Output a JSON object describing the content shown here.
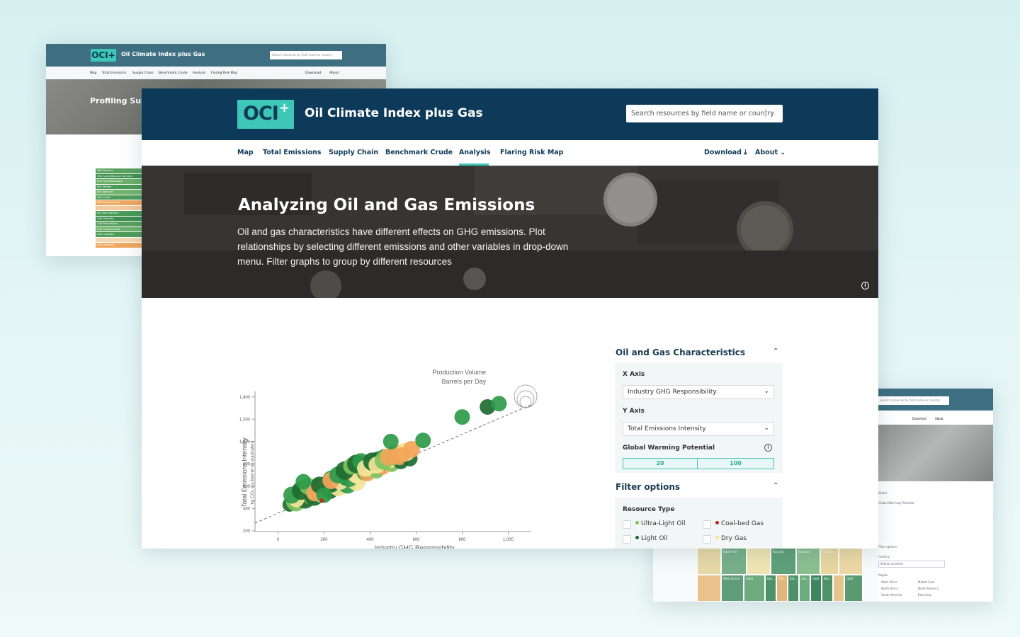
{
  "back_left": {
    "logo_text": "OCI+",
    "title": "Oil Climate Index plus Gas",
    "search_placeholder": "Search resources by field name or country",
    "nav": [
      "Map",
      "Total Emissions",
      "Supply Chain",
      "Benchmark Crude",
      "Analysis",
      "Flaring Risk Map"
    ],
    "download": "Download",
    "about": "About",
    "hero_title": "Profiling Sup",
    "bars": [
      "MEX Tecilisco",
      "VEN Santa Barbara Complex",
      "RUS Kuyumbinskoye",
      "IRN Salman",
      "IRN Agha Jari",
      "SAU Kruda",
      "NYR Wholy Cojang",
      "",
      "IRN Bibi Hakimeh",
      "USA Placerita",
      "CAN Peace River",
      "RUS Surakhanneft",
      "USA Coalinga",
      "",
      "SAU Trebeane"
    ]
  },
  "back_right": {
    "search_placeholder": "Search resources by field name or country",
    "download": "Download",
    "about": "About",
    "model_label": "Model",
    "gwp_label": "Global Warming Potential",
    "filter_label": "Filter options",
    "country_label": "Country",
    "country_placeholder": "Select countries",
    "region_label": "Region",
    "regions": [
      "West Africa",
      "Middle East",
      "North Africa",
      "North America",
      "South America",
      "East Asia"
    ],
    "tree_cells": [
      "Balder UK",
      "Kuruala",
      "Sulaiyah",
      "Ghitsha",
      "West Qurna",
      "Zakit",
      "Bak...",
      "Oth...",
      "Kat...",
      "Zuk...",
      "Gaid",
      "Bani",
      "Qatif"
    ]
  },
  "header": {
    "logo_text": "OCI",
    "logo_plus": "+",
    "title": "Oil Climate Index plus Gas",
    "search_placeholder": "Search resources by field name or country",
    "search_chevron": "⌄"
  },
  "nav": {
    "items": [
      "Map",
      "Total Emissions",
      "Supply Chain",
      "Benchmark Crude",
      "Analysis",
      "Flaring Risk Map"
    ],
    "active": "Analysis",
    "download": "Download ⤓",
    "about": "About ⌄"
  },
  "hero": {
    "title": "Analyzing Oil and Gas Emissions",
    "description": "Oil and gas characteristics have different effects on GHG emissions. Plot relationships by selecting different emissions and other variables in drop-down menu. Filter graphs to group by different resources",
    "info": "i"
  },
  "chart_data": {
    "type": "scatter",
    "xlabel": "Industry GHG Responsibility",
    "ylabel": "Total Emissions Intensity",
    "ylabel_sub": "kg CO₂ eq./barrel oil equivalent",
    "size_legend": [
      "Production Volume",
      "Barrels per Day"
    ],
    "xlim": [
      -100,
      1100
    ],
    "ylim": [
      200,
      1500
    ],
    "x_ticks": [
      0,
      200,
      400,
      600,
      800,
      "1,000"
    ],
    "y_ticks": [
      200,
      400,
      600,
      800,
      "1,000",
      "1,200",
      "1,400"
    ],
    "trend": {
      "x0": -100,
      "y0": 270,
      "x1": 1100,
      "y1": 1330
    },
    "colors": {
      "dark_green": "#1e6b32",
      "green": "#2e9a4a",
      "light_green": "#7ec25e",
      "yellow": "#f3e59a",
      "orange": "#f3a55a",
      "red": "#b8241c"
    },
    "points": [
      {
        "x": 80,
        "y": 480,
        "r": 11,
        "c": "#f3e59a"
      },
      {
        "x": 60,
        "y": 520,
        "r": 12,
        "c": "#2e9a4a"
      },
      {
        "x": 100,
        "y": 560,
        "r": 13,
        "c": "#1e6b32"
      },
      {
        "x": 130,
        "y": 600,
        "r": 12,
        "c": "#7ec25e"
      },
      {
        "x": 110,
        "y": 640,
        "r": 11,
        "c": "#2e9a4a"
      },
      {
        "x": 160,
        "y": 540,
        "r": 12,
        "c": "#f3a55a"
      },
      {
        "x": 180,
        "y": 610,
        "r": 12,
        "c": "#1e6b32"
      },
      {
        "x": 200,
        "y": 520,
        "r": 11,
        "c": "#2e9a4a"
      },
      {
        "x": 190,
        "y": 470,
        "r": 3,
        "c": "#b8241c"
      },
      {
        "x": 230,
        "y": 650,
        "r": 12,
        "c": "#f3a55a"
      },
      {
        "x": 260,
        "y": 700,
        "r": 12,
        "c": "#2e9a4a"
      },
      {
        "x": 290,
        "y": 740,
        "r": 13,
        "c": "#1e6b32"
      },
      {
        "x": 320,
        "y": 780,
        "r": 12,
        "c": "#7ec25e"
      },
      {
        "x": 340,
        "y": 800,
        "r": 13,
        "c": "#1e6b32"
      },
      {
        "x": 360,
        "y": 820,
        "r": 12,
        "c": "#2e9a4a"
      },
      {
        "x": 380,
        "y": 760,
        "r": 12,
        "c": "#f3e59a"
      },
      {
        "x": 410,
        "y": 820,
        "r": 13,
        "c": "#1e6b32"
      },
      {
        "x": 430,
        "y": 790,
        "r": 12,
        "c": "#f3e59a"
      },
      {
        "x": 460,
        "y": 830,
        "r": 13,
        "c": "#7ec25e"
      },
      {
        "x": 480,
        "y": 860,
        "r": 12,
        "c": "#f3a55a"
      },
      {
        "x": 490,
        "y": 1000,
        "r": 11,
        "c": "#2e9a4a"
      },
      {
        "x": 540,
        "y": 880,
        "r": 11,
        "c": "#f3a55a"
      },
      {
        "x": 580,
        "y": 930,
        "r": 12,
        "c": "#f3a55a"
      },
      {
        "x": 630,
        "y": 1010,
        "r": 11,
        "c": "#2e9a4a"
      },
      {
        "x": 800,
        "y": 1220,
        "r": 11,
        "c": "#2e9a4a"
      },
      {
        "x": 910,
        "y": 1310,
        "r": 11,
        "c": "#1e6b32"
      },
      {
        "x": 960,
        "y": 1340,
        "r": 11,
        "c": "#2e9a4a"
      }
    ]
  },
  "panel": {
    "section1_title": "Oil and Gas Characteristics",
    "x_axis_label": "X Axis",
    "x_axis_value": "Industry GHG Responsibility",
    "y_axis_label": "Y Axis",
    "y_axis_value": "Total Emissions Intensity",
    "gwp_label": "Global Warming Potential",
    "gwp_options": [
      "20",
      "100"
    ],
    "section2_title": "Filter options",
    "resource_type_label": "Resource Type",
    "resource_types": [
      {
        "label": "Ultra-Light Oil",
        "color": "#7ec25e"
      },
      {
        "label": "Coal-bed Gas",
        "color": "#b8241c"
      },
      {
        "label": "Light Oil",
        "color": "#1e6b32"
      },
      {
        "label": "Dry Gas",
        "color": "#f3e59a"
      }
    ],
    "chevron_up": "⌃",
    "chevron_down": "⌄",
    "info": "i"
  }
}
